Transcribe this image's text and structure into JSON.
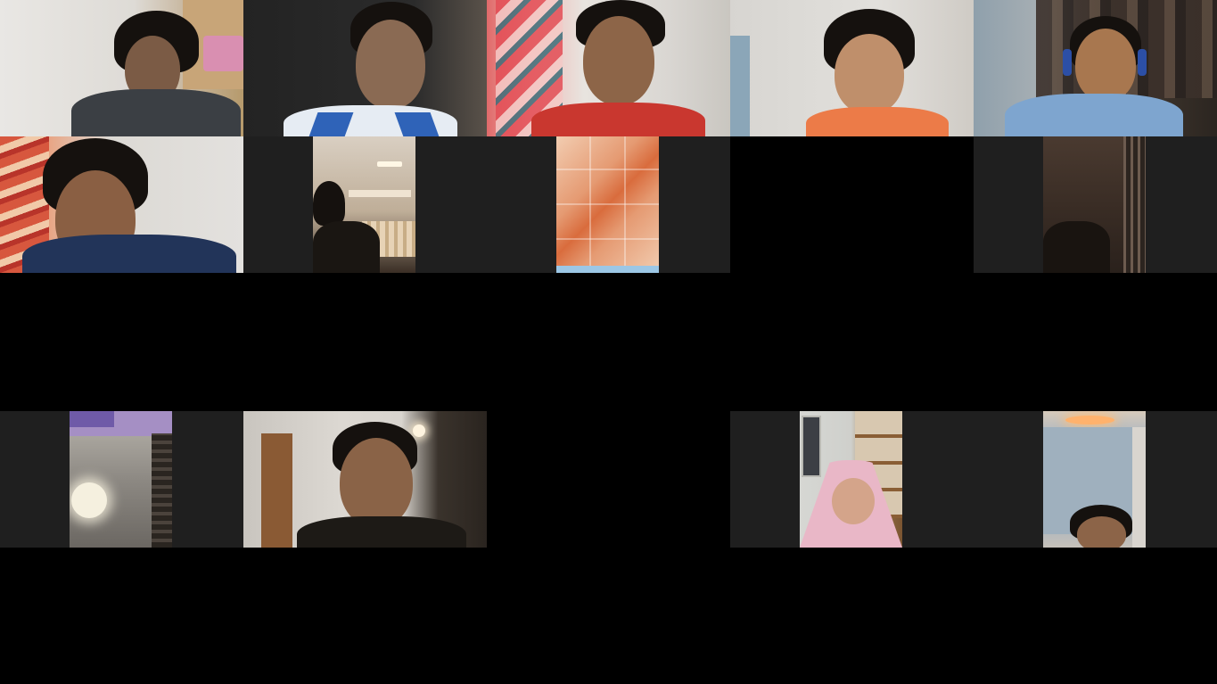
{
  "meeting": {
    "layout": "gallery-view",
    "tile_background": "#1f1f1f",
    "stage_background": "#000000"
  },
  "participants": [
    {
      "id": "p1",
      "video": "on"
    },
    {
      "id": "p2",
      "video": "on"
    },
    {
      "id": "p3",
      "video": "on"
    },
    {
      "id": "p4",
      "video": "on"
    },
    {
      "id": "p5",
      "video": "on"
    },
    {
      "id": "p6",
      "video": "on"
    },
    {
      "id": "p7",
      "video": "on"
    },
    {
      "id": "p8",
      "video": "on"
    },
    {
      "id": "p9",
      "video": "off"
    },
    {
      "id": "p10",
      "video": "on"
    },
    {
      "id": "p11",
      "video": "on"
    },
    {
      "id": "p12",
      "video": "on"
    },
    {
      "id": "p13",
      "video": "on"
    },
    {
      "id": "p14",
      "video": "on"
    }
  ]
}
